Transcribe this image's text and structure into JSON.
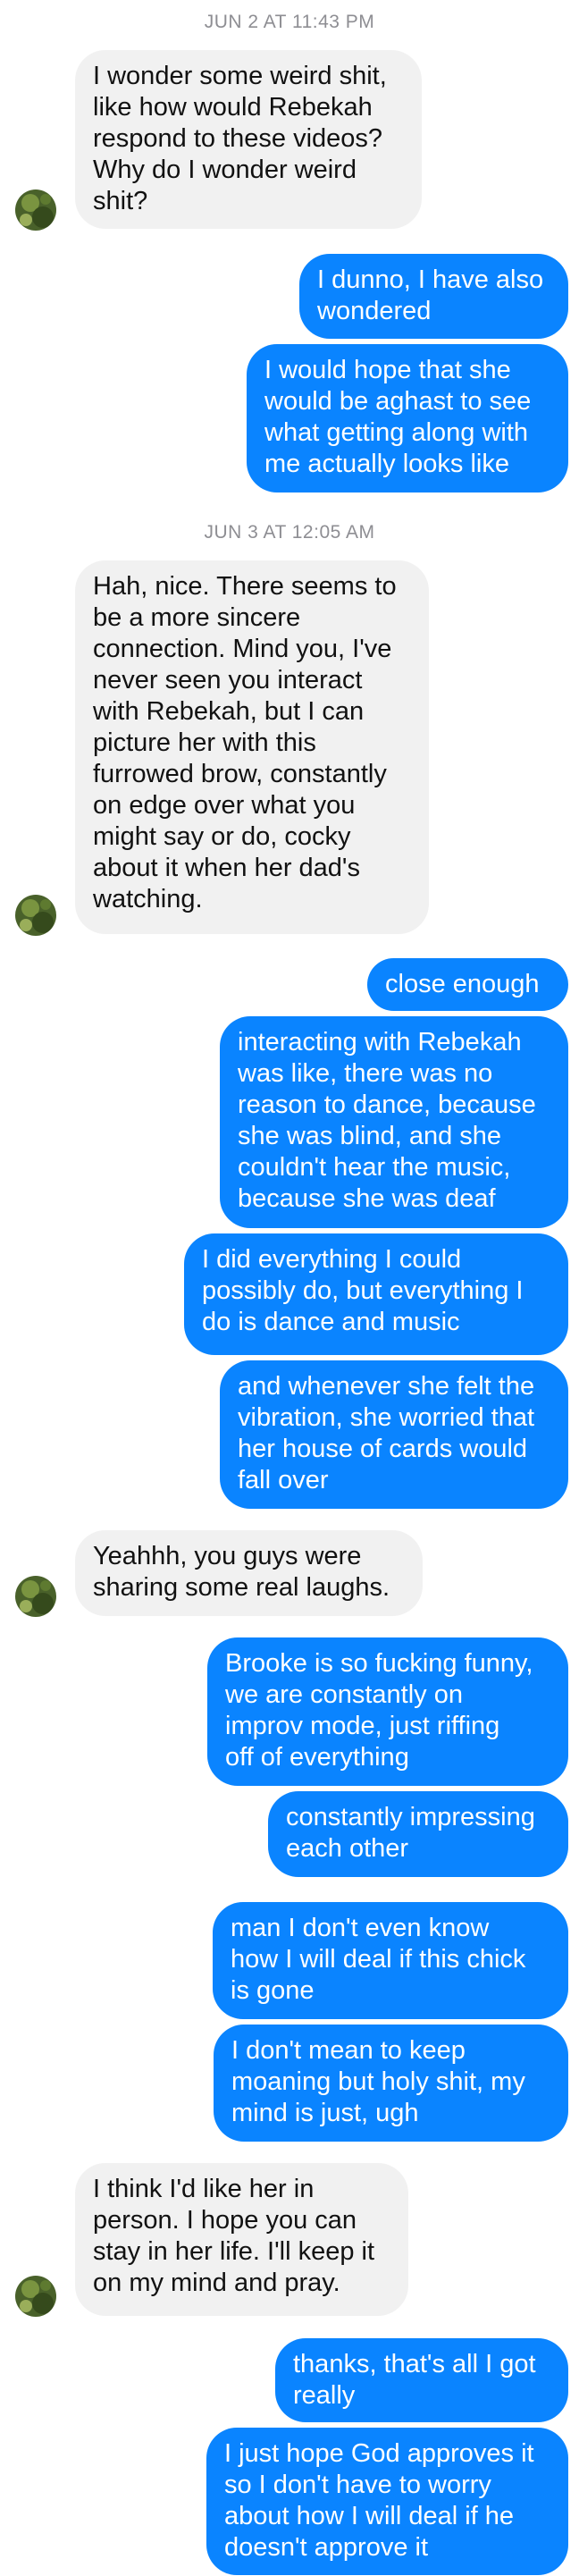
{
  "colors": {
    "incoming_bubble": "#f1f1f1",
    "outgoing_bubble": "#0a84ff",
    "timestamp_text": "#8e8e93"
  },
  "timestamps": [
    "JUN 2 AT 11:43 PM",
    "JUN 3 AT 12:05 AM"
  ],
  "messages": [
    {
      "direction": "incoming",
      "text": "I wonder some weird shit,\nlike how would Rebekah\nrespond to these videos?\nWhy do I wonder weird\nshit?"
    },
    {
      "direction": "outgoing",
      "text": "I dunno, I have also\nwondered"
    },
    {
      "direction": "outgoing",
      "text": "I would hope that she\nwould be aghast to see\nwhat getting along with\nme actually looks like"
    },
    {
      "direction": "incoming",
      "text": "Hah, nice. There seems to\nbe a more sincere\nconnection. Mind you, I've\nnever seen you interact\nwith Rebekah, but I can\npicture her with this\nfurrowed brow, constantly\non edge over what you\nmight say or do, cocky\nabout it when her dad's\nwatching."
    },
    {
      "direction": "outgoing",
      "text": "close enough"
    },
    {
      "direction": "outgoing",
      "text": "interacting with Rebekah\nwas like, there was no\nreason to dance, because\nshe was blind, and she\ncouldn't hear the music,\nbecause she was deaf"
    },
    {
      "direction": "outgoing",
      "text": "I did everything I could\npossibly do, but everything I\ndo is dance and music"
    },
    {
      "direction": "outgoing",
      "text": "and whenever she felt the\nvibration, she worried that\nher house of cards would\nfall over"
    },
    {
      "direction": "incoming",
      "text": "Yeahhh, you guys were\nsharing some real laughs."
    },
    {
      "direction": "outgoing",
      "text": "Brooke is so fucking funny,\nwe are constantly on\nimprov mode, just riffing\noff of everything"
    },
    {
      "direction": "outgoing",
      "text": "constantly impressing\neach other"
    },
    {
      "direction": "outgoing",
      "text": "man I don't even know\nhow I will deal if this chick\nis gone"
    },
    {
      "direction": "outgoing",
      "text": "I don't mean to keep\nmoaning but holy shit, my\nmind is just, ugh"
    },
    {
      "direction": "incoming",
      "text": "I think I'd like her in\nperson. I hope you can\nstay in her life. I'll keep it\non my mind and pray."
    },
    {
      "direction": "outgoing",
      "text": "thanks, that's all I got\nreally"
    },
    {
      "direction": "outgoing",
      "text": "I just hope God approves it\nso I don't have to worry\nabout how I will deal if he\ndoesn't approve it"
    }
  ],
  "avatar_icon": "contact-avatar"
}
